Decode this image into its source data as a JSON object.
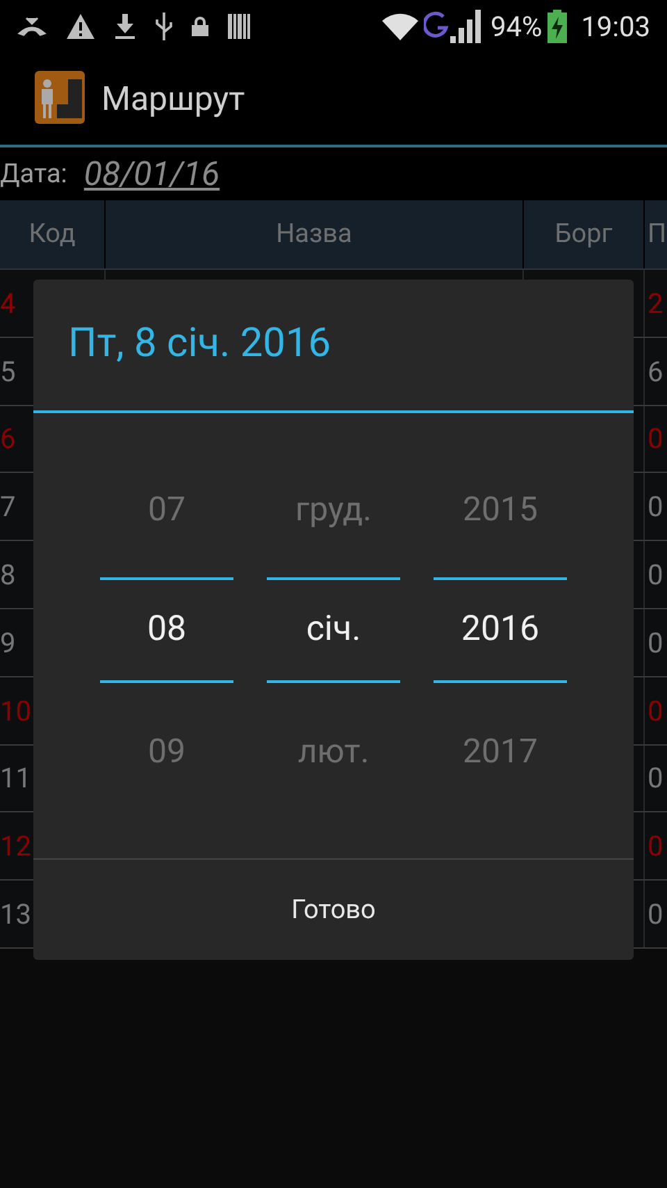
{
  "status_bar": {
    "battery": "94%",
    "time": "19:03"
  },
  "app_bar": {
    "title": "Маршрут"
  },
  "date_field": {
    "label": "Дата:",
    "value": "08/01/16"
  },
  "table": {
    "columns": [
      "Код",
      "Назва",
      "Борг",
      "П"
    ],
    "rows": [
      {
        "code": "4",
        "column_4": "2",
        "highlighted": true
      },
      {
        "code": "5",
        "column_4": "6",
        "highlighted": false
      },
      {
        "code": "6",
        "column_4": "0",
        "highlighted": true
      },
      {
        "code": "7",
        "column_4": "0",
        "highlighted": false
      },
      {
        "code": "8",
        "column_4": "0",
        "highlighted": false
      },
      {
        "code": "9",
        "column_4": "0",
        "highlighted": false
      },
      {
        "code": "10",
        "column_4": "0",
        "highlighted": true
      },
      {
        "code": "11",
        "column_4": "0",
        "highlighted": false
      },
      {
        "code": "12",
        "column_4": "0",
        "highlighted": true
      },
      {
        "code": "13",
        "column_4": "0",
        "highlighted": false
      }
    ]
  },
  "date_dialog": {
    "title": "Пт, 8 січ. 2016",
    "pickers": [
      {
        "previous": "07",
        "value": "08",
        "next": "09"
      },
      {
        "previous": "груд.",
        "value": "січ.",
        "next": "лют."
      },
      {
        "previous": "2015",
        "value": "2016",
        "next": "2017"
      }
    ],
    "button": "Готово"
  }
}
